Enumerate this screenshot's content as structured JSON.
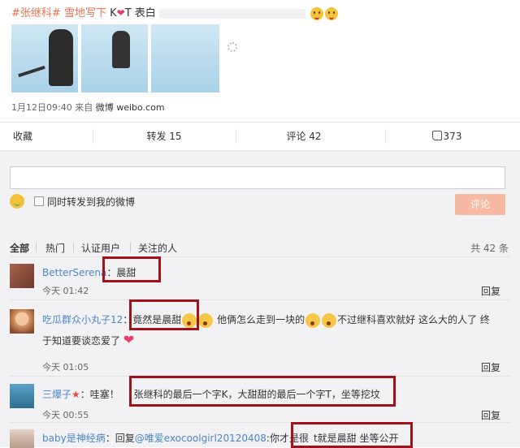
{
  "post": {
    "tag1": "#张继科#",
    "tag2": "雪地写下",
    "text_mid": " K",
    "heart": "❤",
    "text_end": "T 表白",
    "meta_date": "1月12日09:40",
    "meta_from": "来自",
    "meta_source": "微博 weibo.com"
  },
  "actions": {
    "bookmark": "收藏",
    "repost": "转发 15",
    "comment": "评论 42",
    "like": "373"
  },
  "composer": {
    "checkbox_label": "同时转发到我的微博",
    "submit": "评论"
  },
  "filters": {
    "all": "全部",
    "hot": "热门",
    "verified": "认证用户",
    "following": "关注的人",
    "total": "共 42 条"
  },
  "comments": [
    {
      "user": "BetterSerena",
      "sep": "：",
      "text": "晨甜",
      "time": "今天 01:42",
      "reply": "回复"
    },
    {
      "user": "吃瓜群众小丸子12",
      "sep": "：",
      "text": "竟然是晨甜",
      "text2": "他俩怎么走到一块的",
      "text3": "不过继科喜欢就好 这么大的人了 终",
      "line2": "于知道要谈恋爱了",
      "time": "今天 01:05",
      "reply": "回复"
    },
    {
      "user": "三爆子",
      "sep": "：",
      "text": "哇塞！",
      "text2": "张继科的最后一个字K，大甜甜的最后一个字T，坐等挖坟",
      "time": "今天 00:55",
      "reply": "回复"
    },
    {
      "user": "baby是神经病",
      "sep": "：",
      "text": "回复",
      "mention": "@唯爱exocoolgirl20120408",
      "text2": ":你才是很",
      "text3": "t就是晨甜 坐等公开"
    }
  ]
}
